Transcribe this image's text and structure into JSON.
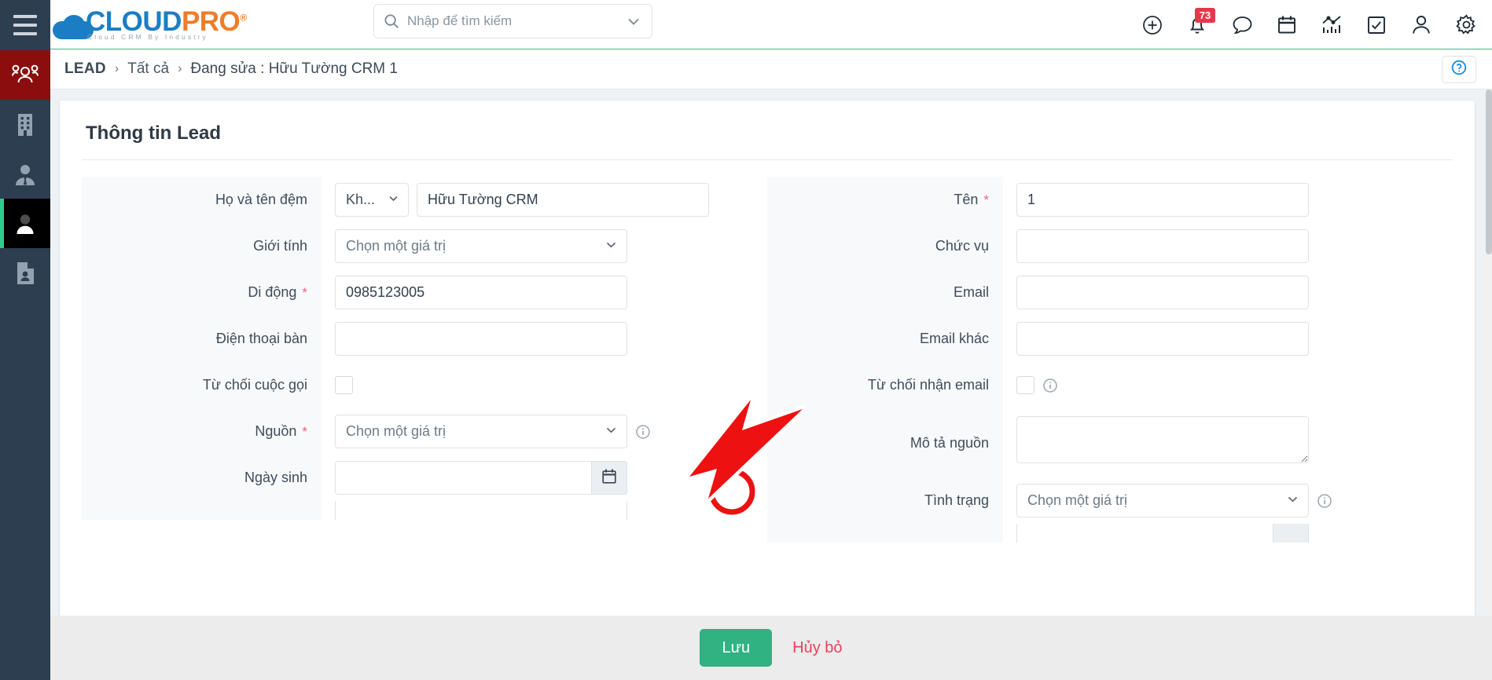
{
  "brand": {
    "name_part1": "CLOUD",
    "name_part2": "PRO",
    "registered": "®",
    "tagline": "Cloud CRM By Industry",
    "blue": "#1b7ec4",
    "orange": "#ef7d28"
  },
  "topbar": {
    "menu_icon": "hamburger-icon",
    "search": {
      "placeholder": "Nhập để tìm kiếm",
      "value": "",
      "icon": "search-icon",
      "caret_icon": "chevron-down-icon"
    },
    "icons": [
      {
        "name": "add-circle-icon",
        "label": ""
      },
      {
        "name": "notifications-bell-icon",
        "label": "",
        "badge": "73",
        "badge_color": "#e8374a"
      },
      {
        "name": "chat-bubble-icon",
        "label": ""
      },
      {
        "name": "calendar-icon",
        "label": ""
      },
      {
        "name": "analytics-chart-icon",
        "label": ""
      },
      {
        "name": "task-checkbox-icon",
        "label": ""
      },
      {
        "name": "user-account-icon",
        "label": ""
      },
      {
        "name": "settings-gear-icon",
        "label": ""
      }
    ]
  },
  "sidebar": {
    "items": [
      {
        "name": "sidebar-item-leads",
        "icon": "people-group-icon",
        "state": "highlighted"
      },
      {
        "name": "sidebar-item-company",
        "icon": "building-icon",
        "state": "normal"
      },
      {
        "name": "sidebar-item-contacts",
        "icon": "person-tie-icon",
        "state": "normal"
      },
      {
        "name": "sidebar-item-lead",
        "icon": "person-icon",
        "state": "active"
      },
      {
        "name": "sidebar-item-reports",
        "icon": "contact-card-icon",
        "state": "normal"
      }
    ]
  },
  "breadcrumb": {
    "root": "LEAD",
    "separator": "›",
    "middle": "Tất cả",
    "current": "Đang sửa : Hữu Tường CRM 1",
    "help_icon": "help-question-icon"
  },
  "form": {
    "title": "Thông tin Lead",
    "placeholder_select": "Chọn một giá trị",
    "left": [
      {
        "label": "Họ và tên đệm",
        "required": false,
        "type": "prefix-text",
        "prefix_value": "Kh...",
        "value": "Hữu Tường CRM"
      },
      {
        "label": "Giới tính",
        "required": false,
        "type": "select",
        "value": "Chọn một giá trị"
      },
      {
        "label": "Di động",
        "required": true,
        "type": "text",
        "value": "0985123005"
      },
      {
        "label": "Điện thoại bàn",
        "required": false,
        "type": "text",
        "value": ""
      },
      {
        "label": "Từ chối cuộc gọi",
        "required": false,
        "type": "checkbox",
        "checked": false
      },
      {
        "label": "Nguồn",
        "required": true,
        "type": "select-info",
        "value": "Chọn một giá trị",
        "info_icon": "info-circle-icon",
        "highlighted": true
      },
      {
        "label": "Ngày sinh",
        "required": false,
        "type": "date",
        "value": "",
        "button_icon": "calendar-icon"
      }
    ],
    "right": [
      {
        "label": "Tên",
        "required": true,
        "type": "text",
        "value": "1"
      },
      {
        "label": "Chức vụ",
        "required": false,
        "type": "text",
        "value": ""
      },
      {
        "label": "Email",
        "required": false,
        "type": "text",
        "value": ""
      },
      {
        "label": "Email khác",
        "required": false,
        "type": "text",
        "value": ""
      },
      {
        "label": "Từ chối nhận email",
        "required": false,
        "type": "checkbox-info",
        "checked": false,
        "info_icon": "info-circle-icon"
      },
      {
        "label": "Mô tả nguồn",
        "required": false,
        "type": "textarea",
        "value": ""
      },
      {
        "label": "Tình trạng",
        "required": false,
        "type": "select-info",
        "value": "Chọn một giá trị",
        "info_icon": "info-circle-icon"
      }
    ]
  },
  "footer": {
    "save_label": "Lưu",
    "cancel_label": "Hủy bỏ",
    "save_color": "#31b283",
    "cancel_color": "#ef3d5e"
  },
  "annotation": {
    "type": "arrow-and-circle-highlight",
    "color": "#e81313",
    "target": "info-circle-icon next to Nguồn select"
  }
}
